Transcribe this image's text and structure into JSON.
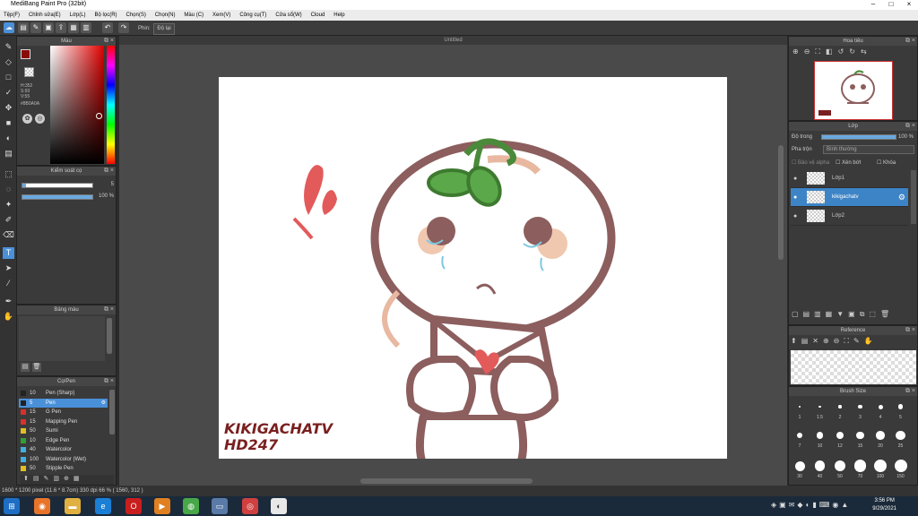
{
  "app": {
    "title": "MediBang Paint Pro (32bit)"
  },
  "menu": [
    "Tệp(F)",
    "Chỉnh sửa(E)",
    "Lớp(L)",
    "Bộ lọc(R)",
    "Chọn(S)",
    "Chọn(N)",
    "Màu (C)",
    "Xem(V)",
    "Công cụ(T)",
    "Cửa sổ(W)",
    "Cloud",
    "Help"
  ],
  "toolopts": {
    "brush_label": "Phin:",
    "brush_value": "Độ lại"
  },
  "color_panel": {
    "title": "Màu",
    "h": "H:352",
    "s": "S:93",
    "v": "V:55",
    "hex": "#8B0A0A",
    "accent": "#8b0a0a"
  },
  "brush_control": {
    "title": "Kiểm soát cọ",
    "size_value": "5",
    "opacity_value": "100 %"
  },
  "color_set": {
    "title": "Bảng màu"
  },
  "brush_panel": {
    "title": "Cọ/Pen",
    "items": [
      {
        "size": "10",
        "name": "Pen (Sharp)",
        "color": "#222222"
      },
      {
        "size": "5",
        "name": "Pen",
        "color": "#222222"
      },
      {
        "size": "15",
        "name": "G Pen",
        "color": "#d9302c"
      },
      {
        "size": "15",
        "name": "Mapping Pen",
        "color": "#d9302c"
      },
      {
        "size": "50",
        "name": "Sumi",
        "color": "#e0c020"
      },
      {
        "size": "10",
        "name": "Edge Pen",
        "color": "#30a030"
      },
      {
        "size": "40",
        "name": "Watercolor",
        "color": "#40b0e0"
      },
      {
        "size": "100",
        "name": "Watercolor (Wet)",
        "color": "#40b0e0"
      },
      {
        "size": "50",
        "name": "Stipple Pen",
        "color": "#e0c020"
      }
    ]
  },
  "document": {
    "tab": "Untitled"
  },
  "artwork": {
    "text_line1": "KIKIGACHATV",
    "text_line2": "HD247"
  },
  "navigator": {
    "title": "Hoa tiêu"
  },
  "layers": {
    "title": "Lớp",
    "opacity_label": "Độ trong",
    "opacity_value": "100 %",
    "blend_label": "Pha trộn",
    "blend_value": "Bình thường",
    "protect_alpha": "Bảo vệ alpha",
    "clipping": "Xén bớt",
    "lock": "Khóa",
    "items": [
      {
        "name": "Lớp1",
        "selected": false
      },
      {
        "name": "kikigachatv",
        "selected": true
      },
      {
        "name": "Lớp2",
        "selected": false
      }
    ]
  },
  "reference": {
    "title": "Reference"
  },
  "brush_size": {
    "title": "Brush Size",
    "labels": [
      "1",
      "1.5",
      "2",
      "3",
      "4",
      "5",
      "7",
      "10",
      "12",
      "15",
      "20",
      "25",
      "30",
      "40",
      "50",
      "70",
      "100",
      "150"
    ]
  },
  "status": {
    "text": "1600 * 1200 pixel  (11.6 * 8.7cm)  330 dpi  66 %  ( 1560, 312 )"
  },
  "taskbar": {
    "time": "3:56 PM",
    "date": "9/29/2021"
  }
}
